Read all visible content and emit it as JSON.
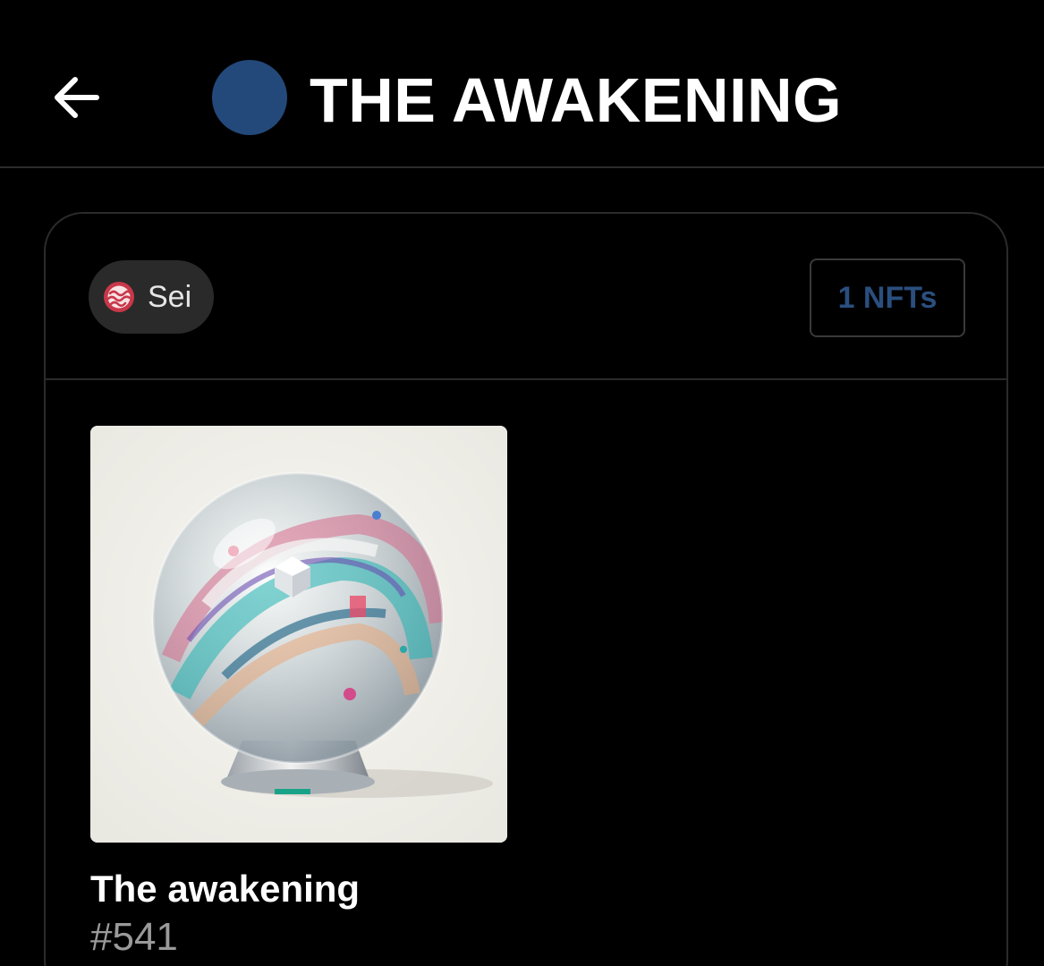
{
  "header": {
    "title": "THE AWAKENING",
    "back_icon": "arrow-left-icon",
    "avatar_color": "#23497a"
  },
  "filters": {
    "chain_label": "Sei",
    "chain_icon": "sei-logo-icon",
    "count_label": "1 NFTs"
  },
  "nfts": [
    {
      "name": "The awakening",
      "token_id": "#541",
      "image": "crystal-ball-artwork"
    }
  ],
  "colors": {
    "background": "#000000",
    "border": "#2b2b2b",
    "chip_background": "#2a2a2a",
    "accent_blue": "#2a4f7f",
    "sei_red": "#c8384a"
  }
}
